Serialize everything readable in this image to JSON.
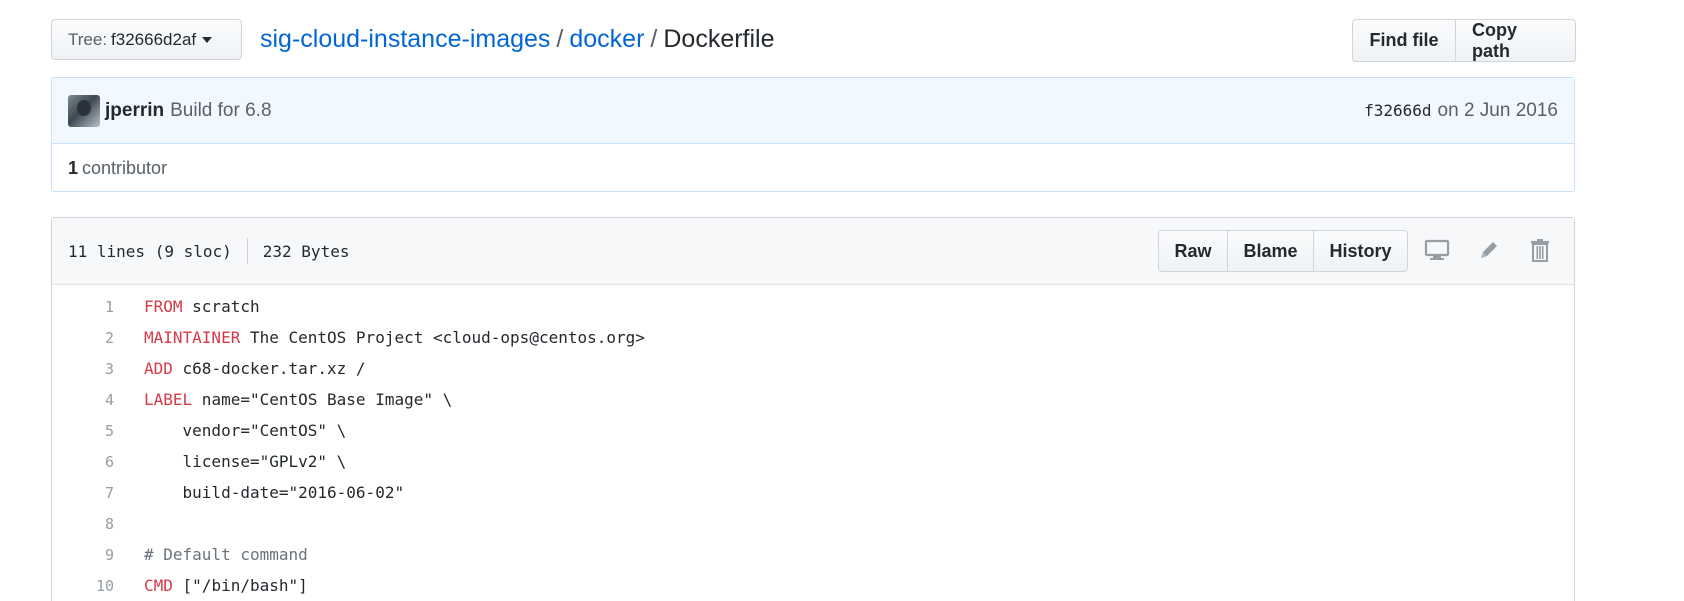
{
  "tree": {
    "label": "Tree:",
    "ref": "f32666d2af"
  },
  "breadcrumb": {
    "repo": "sig-cloud-instance-images",
    "sep": "/",
    "dir": "docker",
    "file": "Dockerfile"
  },
  "top_actions": {
    "find_file": "Find file",
    "copy_path": "Copy path"
  },
  "commit": {
    "author": "jperrin",
    "message": "Build for 6.8",
    "sha": "f32666d",
    "date_text": "on 2 Jun 2016"
  },
  "contributors": {
    "count": "1",
    "label": "contributor"
  },
  "file": {
    "lines_info": "11 lines (9 sloc)",
    "size": "232 Bytes",
    "actions": {
      "raw": "Raw",
      "blame": "Blame",
      "history": "History"
    },
    "icons": [
      "desktop-icon",
      "pencil-icon",
      "trash-icon"
    ]
  },
  "code_lines": [
    {
      "num": "1",
      "kw": "FROM",
      "rest": " scratch",
      "comment": ""
    },
    {
      "num": "2",
      "kw": "MAINTAINER",
      "rest": " The CentOS Project <cloud-ops@centos.org>",
      "comment": ""
    },
    {
      "num": "3",
      "kw": "ADD",
      "rest": " c68-docker.tar.xz /",
      "comment": ""
    },
    {
      "num": "4",
      "kw": "LABEL",
      "rest": " name=\"CentOS Base Image\" \\",
      "comment": ""
    },
    {
      "num": "5",
      "kw": "",
      "rest": "    vendor=\"CentOS\" \\",
      "comment": ""
    },
    {
      "num": "6",
      "kw": "",
      "rest": "    license=\"GPLv2\" \\",
      "comment": ""
    },
    {
      "num": "7",
      "kw": "",
      "rest": "    build-date=\"2016-06-02\"",
      "comment": ""
    },
    {
      "num": "8",
      "kw": "",
      "rest": "",
      "comment": ""
    },
    {
      "num": "9",
      "kw": "",
      "rest": "",
      "comment": "# Default command"
    },
    {
      "num": "10",
      "kw": "CMD",
      "rest": " [\"/bin/bash\"]",
      "comment": ""
    }
  ]
}
